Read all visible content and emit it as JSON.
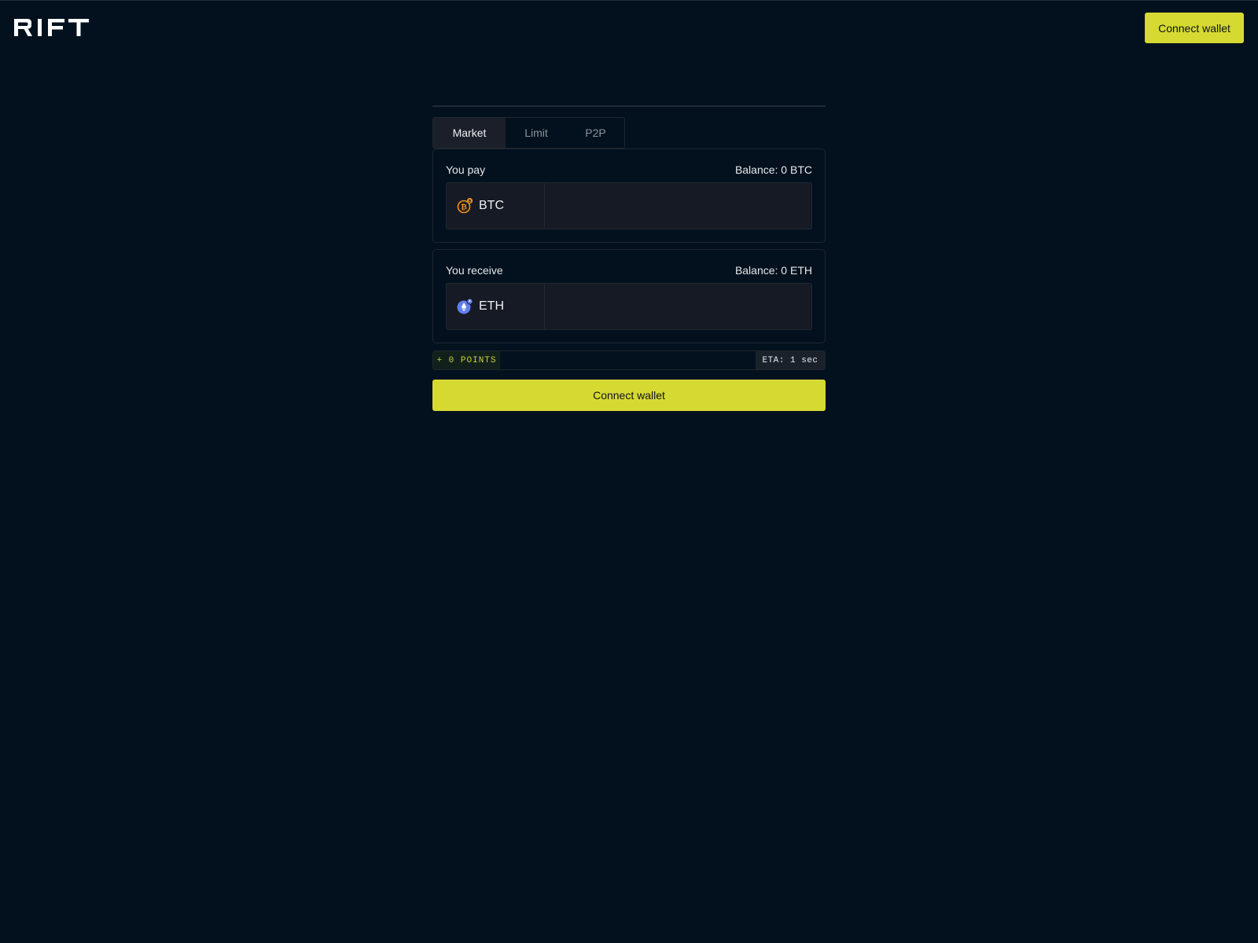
{
  "brand": {
    "logo_text": "RIFT"
  },
  "header": {
    "connect_label": "Connect wallet"
  },
  "tabs": [
    {
      "label": "Market",
      "active": true
    },
    {
      "label": "Limit",
      "active": false
    },
    {
      "label": "P2P",
      "active": false
    }
  ],
  "pay": {
    "label": "You pay",
    "balance": "Balance: 0  BTC",
    "token": "BTC",
    "token_icon": "bitcoin-icon",
    "amount": ""
  },
  "receive": {
    "label": "You receive",
    "balance": "Balance: 0 ETH",
    "token": "ETH",
    "token_icon": "ethereum-icon",
    "amount": ""
  },
  "info": {
    "points": "+ 0 POINTS",
    "eta": "ETA: 1 sec"
  },
  "action": {
    "connect_label": "Connect wallet"
  },
  "colors": {
    "background": "#02111d",
    "accent": "#d6d932",
    "bitcoin": "#f7931a",
    "ethereum": "#627eea"
  }
}
